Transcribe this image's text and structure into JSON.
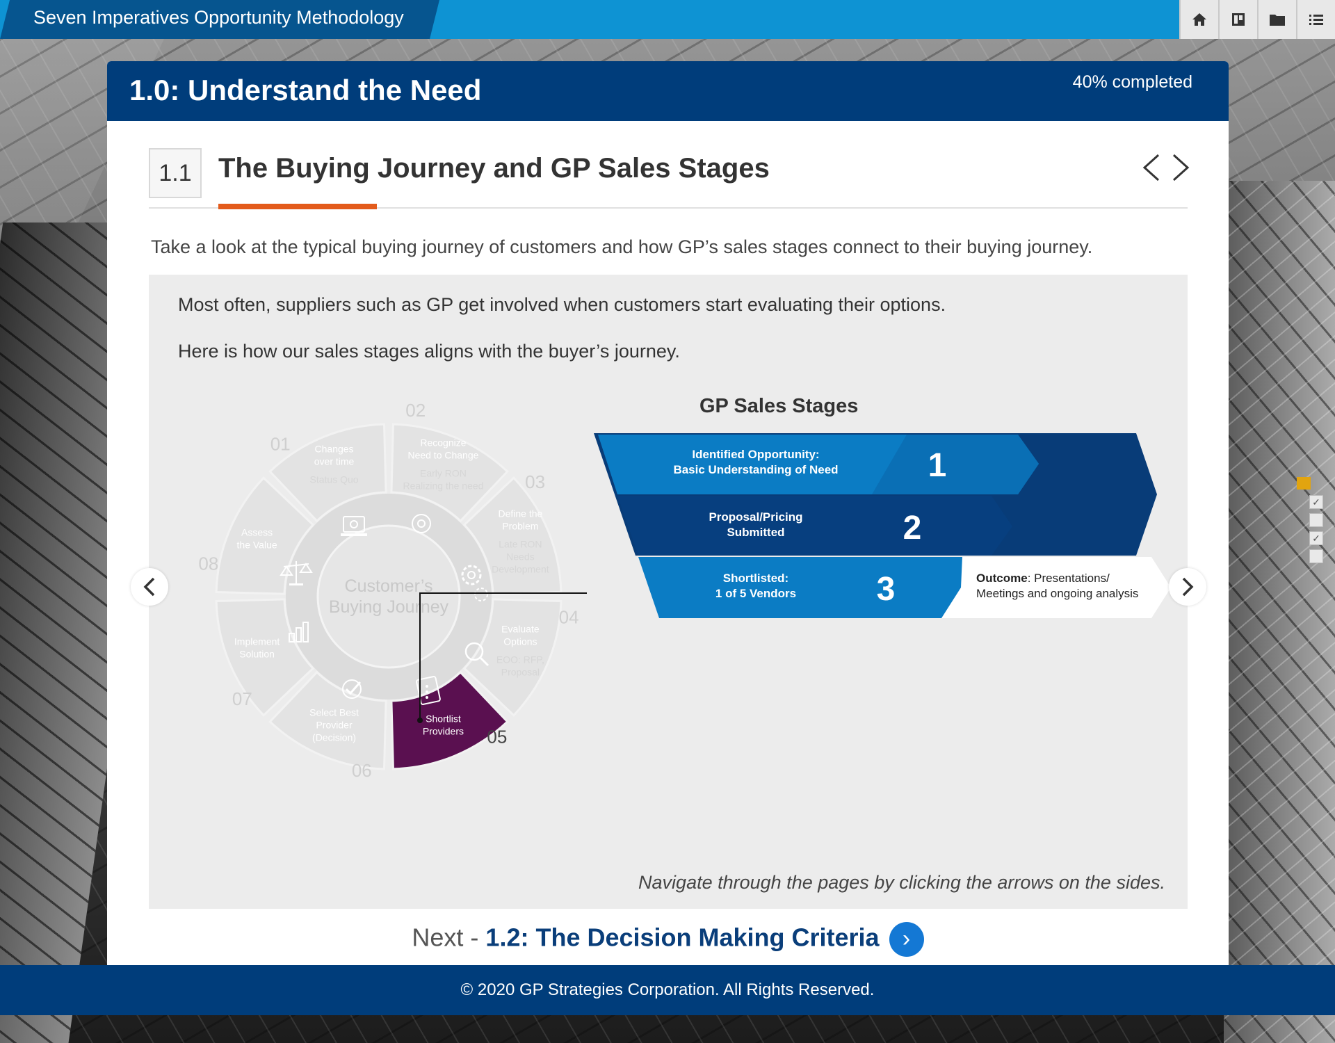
{
  "app": {
    "title": "Seven Imperatives Opportunity Methodology"
  },
  "toolbar": {
    "icons": [
      "home-icon",
      "board-icon",
      "folder-icon",
      "menu-list-icon"
    ]
  },
  "module": {
    "title": "1.0: Understand the Need",
    "progress_text": "40% completed",
    "progress_value": 0.4
  },
  "section": {
    "number": "1.1",
    "title": "The Buying Journey and GP Sales Stages",
    "intro": "Take a look at the typical buying journey of customers and how GP’s sales stages connect to their buying journey."
  },
  "panel": {
    "p1": "Most often, suppliers such as GP get involved when customers start evaluating their options.",
    "p2": "Here is how our sales stages aligns with the buyer’s journey.",
    "nav_tip": "Navigate through the pages by clicking the arrows on the sides."
  },
  "wheel": {
    "center": [
      "Customer’s",
      "Buying Journey"
    ],
    "segments": [
      {
        "num": "01",
        "label": [
          "Changes",
          "over time"
        ],
        "sub": [
          "Status Quo"
        ]
      },
      {
        "num": "02",
        "label": [
          "Recognize",
          "Need to Change"
        ],
        "sub": [
          "Early RON",
          "Realizing the need"
        ]
      },
      {
        "num": "03",
        "label": [
          "Define the",
          "Problem"
        ],
        "sub": [
          "Late RON",
          "Needs",
          "Development"
        ]
      },
      {
        "num": "04",
        "label": [
          "Evaluate",
          "Options"
        ],
        "sub": [
          "EOO: RFP,",
          "Proposal"
        ]
      },
      {
        "num": "05",
        "label": [
          "Shortlist",
          "Providers"
        ],
        "sub": []
      },
      {
        "num": "06",
        "label": [
          "Select Best",
          "Provider",
          "(Decision)"
        ],
        "sub": []
      },
      {
        "num": "07",
        "label": [
          "Implement",
          "Solution"
        ],
        "sub": []
      },
      {
        "num": "08",
        "label": [
          "Assess",
          "the Value"
        ],
        "sub": []
      }
    ]
  },
  "stages": {
    "title": "GP Sales Stages",
    "items": [
      {
        "num": "1",
        "label": [
          "Identified Opportunity:",
          "Basic Understanding of Need"
        ]
      },
      {
        "num": "2",
        "label": [
          "Proposal/Pricing",
          "Submitted"
        ]
      },
      {
        "num": "3",
        "label": [
          "Shortlisted:",
          "1 of 5 Vendors"
        ]
      }
    ],
    "outcome_label": "Outcome",
    "outcome_text": [
      "Presentations/",
      "Meetings and ongoing analysis"
    ]
  },
  "next": {
    "prefix": "Next - ",
    "link": "1.2: The Decision Making Criteria"
  },
  "footer": {
    "text": "© 2020 GP Strategies Corporation. All Rights Reserved."
  },
  "page_progress": {
    "current_marker": "current-page",
    "items": [
      {
        "checked": true
      },
      {
        "checked": false
      },
      {
        "checked": true
      },
      {
        "checked": false
      }
    ]
  },
  "colors": {
    "header": "#003d7b",
    "topbar": "#0e93d3",
    "accent": "#e35b1b",
    "highlight": "#5a1050",
    "stage_blue": "#0a79c2",
    "stage_dark": "#063f80"
  }
}
